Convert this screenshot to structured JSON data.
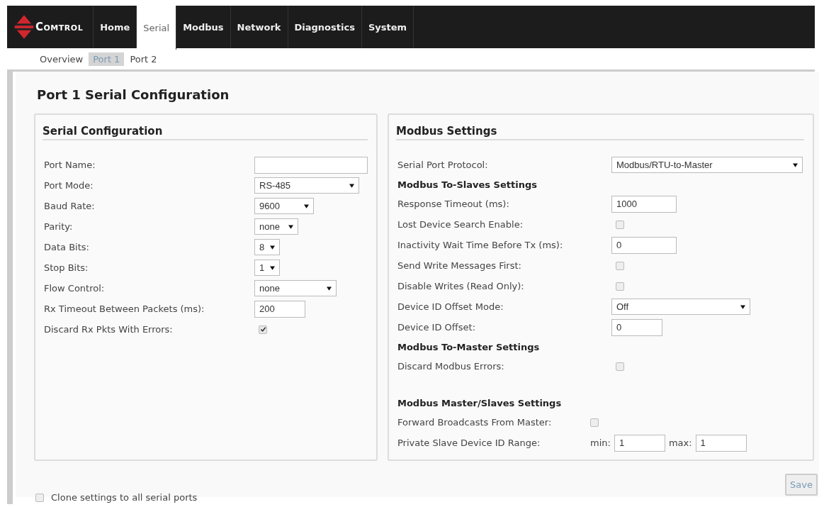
{
  "brand": "Comtrol",
  "nav": [
    {
      "label": "Home",
      "selected": false
    },
    {
      "label": "Serial",
      "selected": true
    },
    {
      "label": "Modbus",
      "selected": false
    },
    {
      "label": "Network",
      "selected": false
    },
    {
      "label": "Diagnostics",
      "selected": false
    },
    {
      "label": "System",
      "selected": false
    }
  ],
  "subnav": [
    {
      "label": "Overview",
      "selected": false
    },
    {
      "label": "Port 1",
      "selected": true
    },
    {
      "label": "Port 2",
      "selected": false
    }
  ],
  "page_title": "Port 1 Serial Configuration",
  "serial_configuration": {
    "title": "Serial Configuration",
    "rows": [
      {
        "kind": "text",
        "label": "Port Name:"
      },
      {
        "kind": "select",
        "label": "Port Mode:",
        "value": "RS-485"
      },
      {
        "kind": "select",
        "label": "Baud Rate:",
        "value": "9600"
      },
      {
        "kind": "select",
        "label": "Parity:",
        "value": "none"
      },
      {
        "kind": "select",
        "label": "Data Bits:",
        "value": "8"
      },
      {
        "kind": "select",
        "label": "Stop Bits:",
        "value": "1"
      },
      {
        "kind": "select",
        "label": "Flow Control:",
        "value": "none"
      },
      {
        "kind": "text",
        "label": "Rx Timeout Between Packets (ms):",
        "value": "200"
      },
      {
        "kind": "checkbox",
        "label": "Discard Rx Pkts With Errors:",
        "checked": true
      }
    ]
  },
  "modbus_settings": {
    "title": "Modbus Settings",
    "rows": [
      {
        "kind": "select",
        "label": "Serial Port Protocol:",
        "value": "Modbus/RTU-to-Master"
      },
      {
        "kind": "heading",
        "label": "Modbus To-Slaves Settings"
      },
      {
        "kind": "text",
        "label": "Response Timeout (ms):",
        "value": "1000"
      },
      {
        "kind": "checkbox",
        "label": "Lost Device Search Enable:",
        "checked": false
      },
      {
        "kind": "text",
        "label": "Inactivity Wait Time Before Tx (ms):",
        "value": "0"
      },
      {
        "kind": "checkbox",
        "label": "Send Write Messages First:",
        "checked": false
      },
      {
        "kind": "checkbox",
        "label": "Disable Writes (Read Only):",
        "checked": false
      },
      {
        "kind": "select",
        "label": "Device ID Offset Mode:",
        "value": "Off"
      },
      {
        "kind": "text",
        "label": "Device ID Offset:",
        "value": "0"
      },
      {
        "kind": "heading",
        "label": "Modbus To-Master Settings"
      },
      {
        "kind": "checkbox",
        "label": "Discard Modbus Errors:",
        "checked": false
      },
      {
        "kind": "spacer"
      },
      {
        "kind": "heading",
        "label": "Modbus Master/Slaves Settings"
      },
      {
        "kind": "checkbox",
        "label": "Forward Broadcasts From Master:",
        "checked": false
      },
      {
        "kind": "range",
        "label": "Private Slave Device ID Range:",
        "min_label": "min:",
        "min": "1",
        "max_label": "max:",
        "max": "1"
      }
    ]
  },
  "clone": {
    "label": "Clone settings to all serial ports",
    "checked": false
  },
  "save_button": "Save"
}
